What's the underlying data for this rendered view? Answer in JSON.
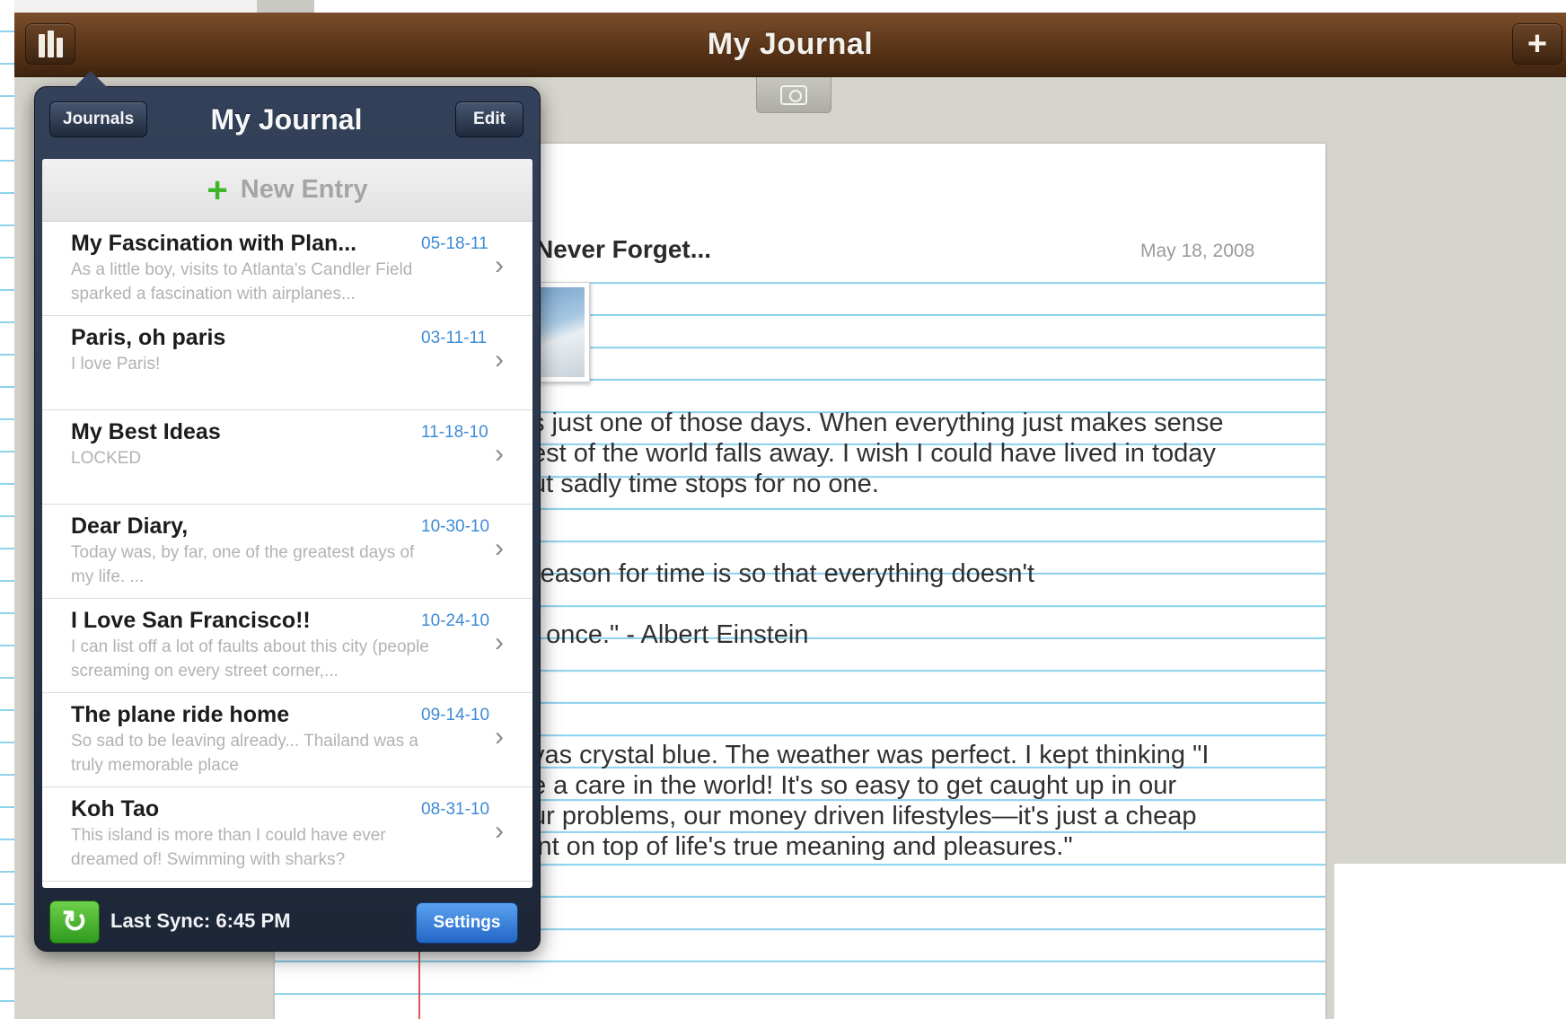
{
  "navbar": {
    "title": "My Journal",
    "left_icon": "journals-books-icon",
    "right_icon": "plus-icon"
  },
  "toolbar": {
    "camera_icon": "camera-icon"
  },
  "entry": {
    "title": "Never Forget...",
    "date": "May 18, 2008",
    "lines": [
      "s just one of those days. When everything just makes sense",
      "est of the world falls away. I wish I could have lived in today",
      "ut sadly time stops for no one.",
      "reason for time is so that everything doesn't",
      "t once.\"    - Albert Einstein",
      "vas crystal blue. The weather was perfect. I kept thinking \"I",
      "e a care in the world! It's so easy to get caught up in our",
      "ur problems, our money driven lifestyles—it's just a cheap",
      "int on top of life's true meaning and pleasures.\""
    ]
  },
  "popover": {
    "journals_label": "Journals",
    "title": "My Journal",
    "edit_label": "Edit",
    "new_entry_label": "New Entry",
    "entries": [
      {
        "title": "My Fascination with Plan...",
        "date": "05-18-11",
        "preview": "As a little boy, visits to Atlanta's Candler Field sparked a fascination with airplanes..."
      },
      {
        "title": "Paris, oh paris",
        "date": "03-11-11",
        "preview": "I love Paris!"
      },
      {
        "title": "My Best Ideas",
        "date": "11-18-10",
        "preview": "LOCKED"
      },
      {
        "title": "Dear Diary,",
        "date": "10-30-10",
        "preview": "Today was, by far, one of the greatest days of my life. ..."
      },
      {
        "title": "I Love San Francisco!!",
        "date": "10-24-10",
        "preview": "I can list off a lot of faults about this city (people screaming on every street corner,..."
      },
      {
        "title": "The plane ride home",
        "date": "09-14-10",
        "preview": "So sad to be leaving already... Thailand was a truly memorable place"
      },
      {
        "title": "Koh Tao",
        "date": "08-31-10",
        "preview": "This island is more than I could have ever dreamed of! Swimming with sharks?"
      }
    ],
    "sync_label": "Last Sync: 6:45 PM",
    "settings_label": "Settings"
  },
  "colors": {
    "navbar_brown": "#5a3518",
    "date_blue": "#3d8bd6",
    "sync_green": "#3fb52a",
    "settings_blue": "#2f7ad8",
    "rule_line": "#8fd2ee",
    "margin_red": "#e05454"
  }
}
